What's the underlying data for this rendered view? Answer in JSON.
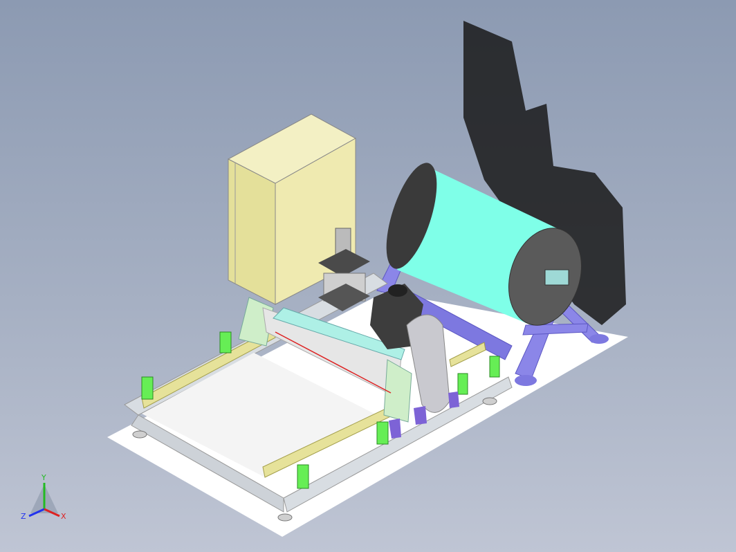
{
  "colors": {
    "background_top": "#8c9ab2",
    "background_bottom": "#bfc5d4",
    "cabinet": "#efeab0",
    "drum": "#7fffe8",
    "stand": "#8b86e8",
    "clamp": "#66ee55",
    "rail": "#e6e29a",
    "motor": "#444444",
    "frame_green": "#cfeec9"
  },
  "triad": {
    "y_label": "Y",
    "z_label": "Z",
    "x_label": "X",
    "y_color": "#22bb22",
    "z_color": "#2233ee",
    "x_color": "#dd2222"
  }
}
